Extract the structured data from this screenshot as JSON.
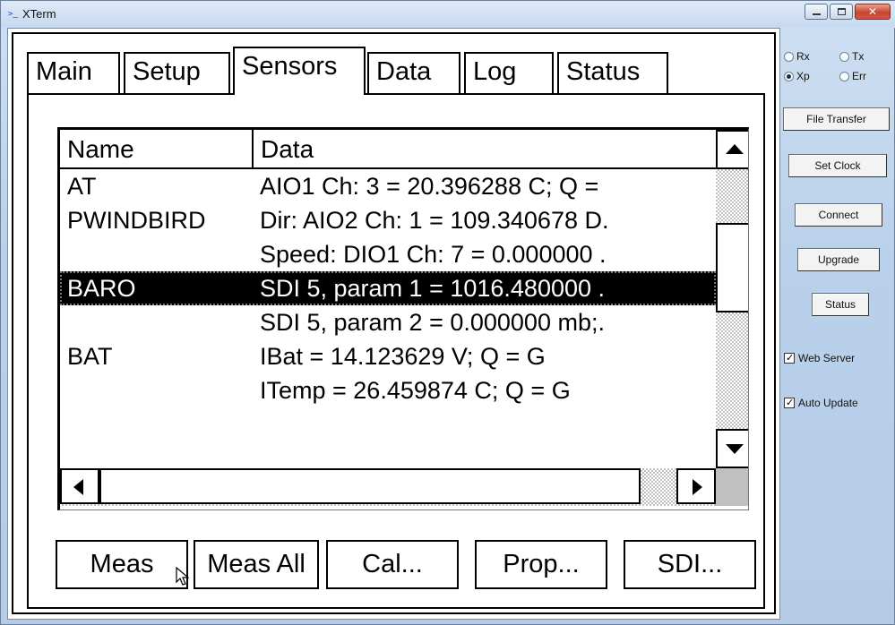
{
  "window": {
    "title": "XTerm",
    "icon_glyph": ">_"
  },
  "tabs": [
    {
      "label": "Main"
    },
    {
      "label": "Setup"
    },
    {
      "label": "Sensors"
    },
    {
      "label": "Data"
    },
    {
      "label": "Log"
    },
    {
      "label": "Status"
    }
  ],
  "active_tab": "Sensors",
  "sensors_table": {
    "headers": {
      "name": "Name",
      "data": "Data"
    },
    "rows": [
      {
        "name": "AT",
        "data": "AIO1 Ch: 3 = 20.396288 C; Q ="
      },
      {
        "name": "PWINDBIRD",
        "data": "Dir: AIO2 Ch: 1 = 109.340678 D."
      },
      {
        "name": "",
        "data": "Speed: DIO1 Ch: 7 = 0.000000 ."
      },
      {
        "name": "BARO",
        "data": "SDI 5, param 1 = 1016.480000 ."
      },
      {
        "name": "",
        "data": "SDI 5, param 2 = 0.000000 mb;."
      },
      {
        "name": "BAT",
        "data": "IBat = 14.123629 V; Q = G"
      },
      {
        "name": "",
        "data": "ITemp = 26.459874 C; Q = G"
      }
    ],
    "selected_row": "BARO"
  },
  "buttons": {
    "meas": "Meas",
    "meas_all": "Meas All",
    "cal": "Cal...",
    "prop": "Prop...",
    "sdi": "SDI..."
  },
  "side_panel": {
    "radios": [
      {
        "label": "Rx",
        "checked": false
      },
      {
        "label": "Tx",
        "checked": false
      },
      {
        "label": "Xp",
        "checked": true
      },
      {
        "label": "Err",
        "checked": false
      }
    ],
    "file_transfer": "File Transfer",
    "set_clock": "Set Clock",
    "connect": "Connect",
    "upgrade": "Upgrade",
    "status": "Status",
    "web_server": {
      "label": "Web Server",
      "checked": true
    },
    "auto_update": {
      "label": "Auto Update",
      "checked": true
    }
  }
}
